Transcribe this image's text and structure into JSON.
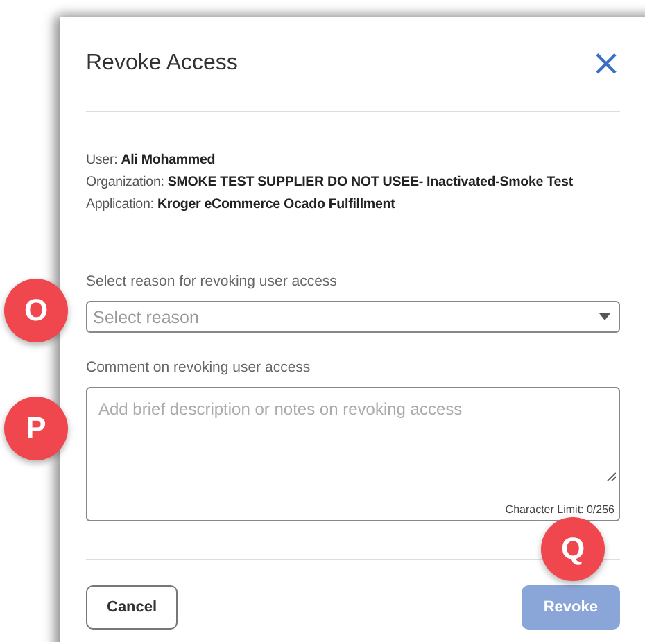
{
  "dialog": {
    "title": "Revoke Access",
    "close": "×",
    "details": [
      {
        "label": "User:",
        "value": "Ali Mohammed"
      },
      {
        "label": "Organization:",
        "value": "SMOKE TEST SUPPLIER DO NOT USEE- Inactivated-Smoke Test"
      },
      {
        "label": "Application:",
        "value": "Kroger eCommerce Ocado Fulfillment"
      }
    ],
    "reason": {
      "label": "Select reason for revoking user access",
      "placeholder": "Select reason"
    },
    "comment": {
      "label": "Comment on revoking user access",
      "placeholder": "Add brief description or notes on revoking access",
      "limit": "Character Limit: 0/256"
    },
    "buttons": [
      {
        "label": "Cancel",
        "kind": "secondary"
      },
      {
        "label": "Revoke",
        "kind": "primary",
        "disabled": true
      }
    ]
  },
  "markers": [
    {
      "label": "O"
    },
    {
      "label": "P"
    },
    {
      "label": "Q"
    }
  ]
}
